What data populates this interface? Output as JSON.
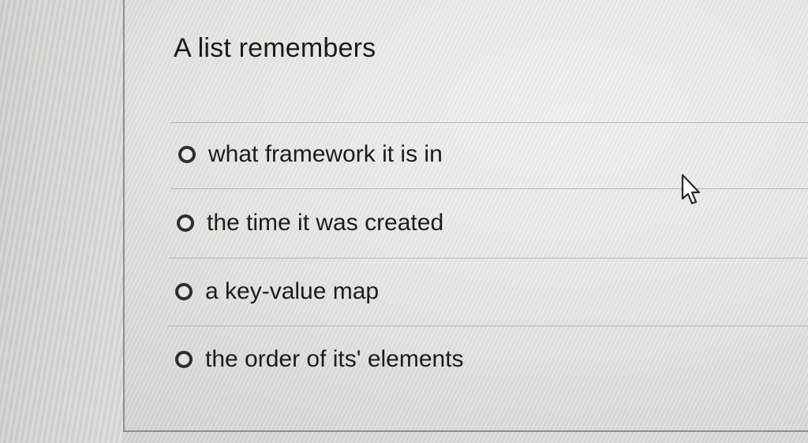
{
  "question": {
    "text": "A list remembers"
  },
  "options": [
    {
      "label": "what framework it is in",
      "selected": false
    },
    {
      "label": "the time it was created",
      "selected": false
    },
    {
      "label": "a key-value map",
      "selected": false
    },
    {
      "label": "the order of its' elements",
      "selected": false
    }
  ],
  "icons": {
    "radio": "radio-button-unselected",
    "cursor": "mouse-pointer-icon"
  },
  "colors": {
    "text": "#1c1c1c",
    "divider": "#b4b7b1",
    "border": "#8c8f8a"
  }
}
